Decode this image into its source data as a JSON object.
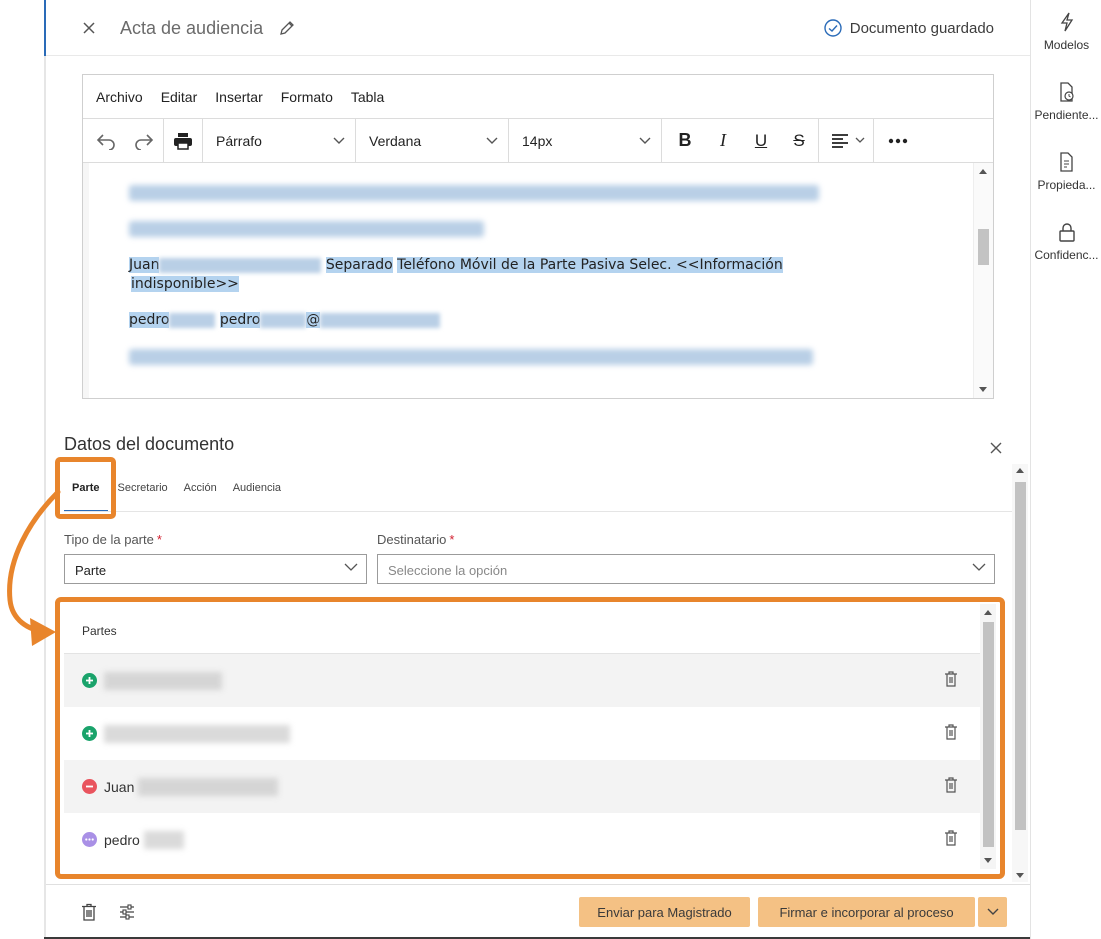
{
  "header": {
    "title": "Acta de audiencia",
    "saved_status": "Documento guardado"
  },
  "editor": {
    "menu": [
      "Archivo",
      "Editar",
      "Insertar",
      "Formato",
      "Tabla"
    ],
    "block_format": "Párrafo",
    "font_family": "Verdana",
    "font_size": "14px",
    "content": {
      "line_juan_first": "Juan",
      "line_juan_middle": "Separado",
      "line_juan_hl": "Teléfono Móvil de la Parte Pasiva Selec. <<Información",
      "line_juan_hl2": "indisponible>>",
      "line_pedro_1": "pedro",
      "line_pedro_2": "pedro",
      "line_pedro_at": "@"
    }
  },
  "sidebar": {
    "items": [
      {
        "label": "Modelos",
        "icon": "lightning-icon"
      },
      {
        "label": "Pendiente...",
        "icon": "pending-document-icon"
      },
      {
        "label": "Propieda...",
        "icon": "properties-document-icon"
      },
      {
        "label": "Confidenc...",
        "icon": "lock-icon"
      }
    ]
  },
  "panel": {
    "title": "Datos del documento",
    "tabs": [
      "Parte",
      "Secretario",
      "Acción",
      "Audiencia"
    ],
    "active_tab": "Parte",
    "tipo_label": "Tipo de la parte",
    "tipo_value": "Parte",
    "destinatario_label": "Destinatario",
    "destinatario_placeholder": "Seleccione la opción",
    "required_mark": "*",
    "partes_header": "Partes",
    "partes": [
      {
        "name": "",
        "status": "add",
        "color": "#1aa36b"
      },
      {
        "name": "",
        "status": "add",
        "color": "#1aa36b"
      },
      {
        "name": "Juan",
        "status": "remove",
        "color": "#e9545e"
      },
      {
        "name": "pedro",
        "status": "pending",
        "color": "#a990e6"
      }
    ]
  },
  "footer": {
    "send_button": "Enviar para Magistrado",
    "sign_button": "Firmar e incorporar al proceso"
  },
  "colors": {
    "accent_orange": "#e8852c",
    "button_orange": "#f4c184",
    "tab_blue": "#2a6bb8",
    "highlight": "#b4d3ef"
  }
}
